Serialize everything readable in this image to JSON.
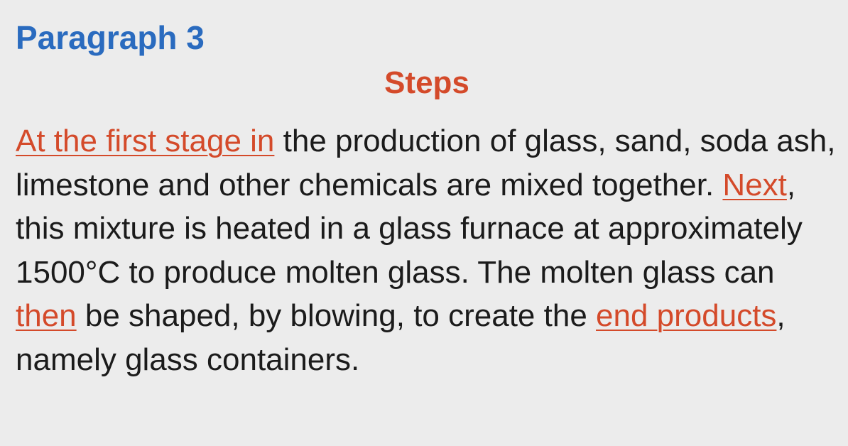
{
  "heading": "Paragraph 3",
  "subheading": "Steps",
  "paragraph": [
    {
      "text": "At the first stage in",
      "highlight": true
    },
    {
      "text": " the production of glass, sand, soda ash, limestone and other chemicals are mixed together. ",
      "highlight": false
    },
    {
      "text": "Next",
      "highlight": true
    },
    {
      "text": ", this mixture is heated in a glass furnace at approximately 1500°C to produce molten glass. The molten glass can ",
      "highlight": false
    },
    {
      "text": "then",
      "highlight": true
    },
    {
      "text": " be shaped, by blowing, to create the ",
      "highlight": false
    },
    {
      "text": "end products",
      "highlight": true
    },
    {
      "text": ", namely glass containers.",
      "highlight": false
    }
  ],
  "colors": {
    "heading": "#2a6bbf",
    "highlight": "#d44a2a",
    "text": "#1b1b1b",
    "background": "#ececec"
  }
}
